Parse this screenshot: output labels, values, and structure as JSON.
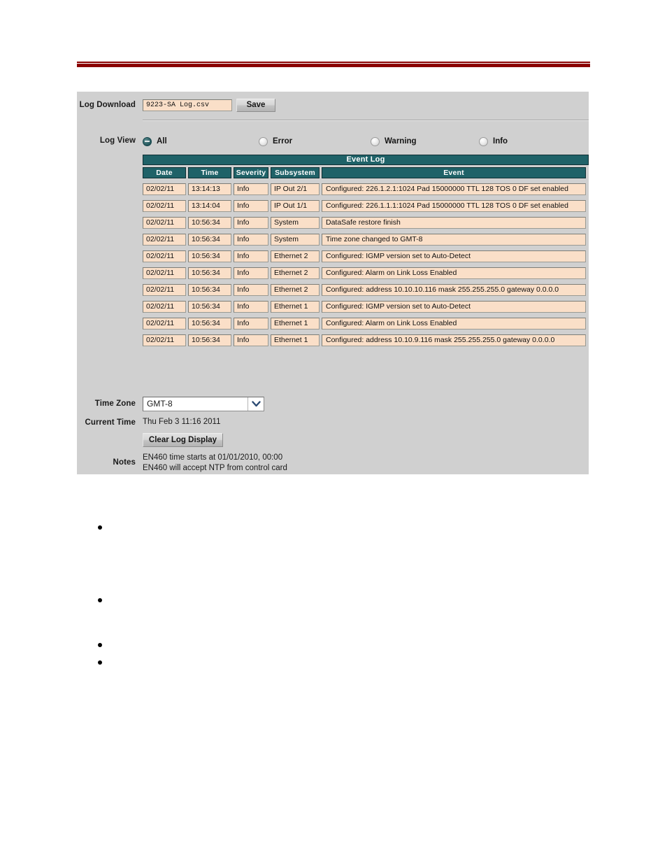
{
  "page": {
    "rule_color": "#8b0000"
  },
  "log_download": {
    "label": "Log Download",
    "filename": "9223-SA Log.csv",
    "save_label": "Save"
  },
  "log_view": {
    "label": "Log View",
    "options": [
      {
        "label": "All",
        "selected": true
      },
      {
        "label": "Error",
        "selected": false
      },
      {
        "label": "Warning",
        "selected": false
      },
      {
        "label": "Info",
        "selected": false
      }
    ]
  },
  "event_log": {
    "title": "Event Log",
    "columns": [
      "Date",
      "Time",
      "Severity",
      "Subsystem",
      "Event"
    ],
    "rows": [
      [
        "02/02/11",
        "13:14:13",
        "Info",
        "IP Out 2/1",
        "Configured: 226.1.2.1:1024 Pad 15000000 TTL 128 TOS 0 DF set enabled"
      ],
      [
        "02/02/11",
        "13:14:04",
        "Info",
        "IP Out 1/1",
        "Configured: 226.1.1.1:1024 Pad 15000000 TTL 128 TOS 0 DF set enabled"
      ],
      [
        "02/02/11",
        "10:56:34",
        "Info",
        "System",
        "DataSafe restore finish"
      ],
      [
        "02/02/11",
        "10:56:34",
        "Info",
        "System",
        "Time zone changed to GMT-8"
      ],
      [
        "02/02/11",
        "10:56:34",
        "Info",
        "Ethernet 2",
        "Configured: IGMP version set to Auto-Detect"
      ],
      [
        "02/02/11",
        "10:56:34",
        "Info",
        "Ethernet 2",
        "Configured: Alarm on Link Loss Enabled"
      ],
      [
        "02/02/11",
        "10:56:34",
        "Info",
        "Ethernet 2",
        "Configured: address 10.10.10.116 mask 255.255.255.0 gateway 0.0.0.0"
      ],
      [
        "02/02/11",
        "10:56:34",
        "Info",
        "Ethernet 1",
        "Configured: IGMP version set to Auto-Detect"
      ],
      [
        "02/02/11",
        "10:56:34",
        "Info",
        "Ethernet 1",
        "Configured: Alarm on Link Loss Enabled"
      ],
      [
        "02/02/11",
        "10:56:34",
        "Info",
        "Ethernet 1",
        "Configured: address 10.10.9.116 mask 255.255.255.0 gateway 0.0.0.0"
      ]
    ]
  },
  "time_zone": {
    "label": "Time Zone",
    "value": "GMT-8"
  },
  "current_time": {
    "label": "Current Time",
    "value": "Thu Feb 3 11:16 2011"
  },
  "clear_log": {
    "label": "Clear Log Display"
  },
  "notes": {
    "label": "Notes",
    "text": "EN460 time starts at 01/01/2010, 00:00\nEN460 will accept NTP from control card"
  }
}
